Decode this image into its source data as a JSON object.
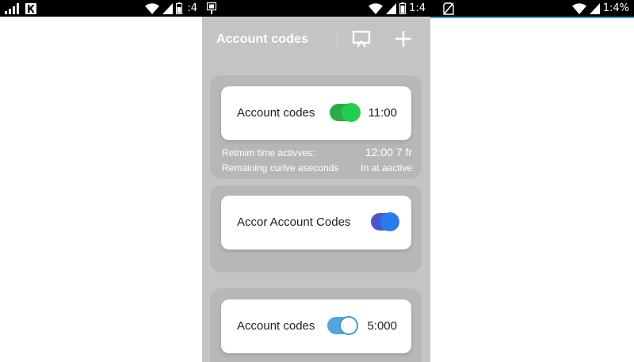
{
  "left_status": {
    "clock": ":4"
  },
  "mid_status": {
    "clock": "1:4"
  },
  "right_status": {
    "clock": "1:4%"
  },
  "app": {
    "title": "Account codes",
    "actions": [
      "cast-icon",
      "add-icon"
    ]
  },
  "cards": [
    {
      "label": "Account codes",
      "time": "11:00",
      "toggle_on": true,
      "accent": "#22cf4d"
    },
    {
      "label": "Accor Account Codes",
      "toggle_on": true,
      "accent": "#2a7af0"
    },
    {
      "label": "Account codes",
      "time": "5:000",
      "toggle_on": true,
      "accent": "#52a8dd"
    }
  ],
  "info": [
    {
      "label": "Retmim time activves:",
      "value": "12:00 7 fr"
    },
    {
      "label": "Remaining curlve aseconds",
      "value": "In at aactive"
    }
  ]
}
